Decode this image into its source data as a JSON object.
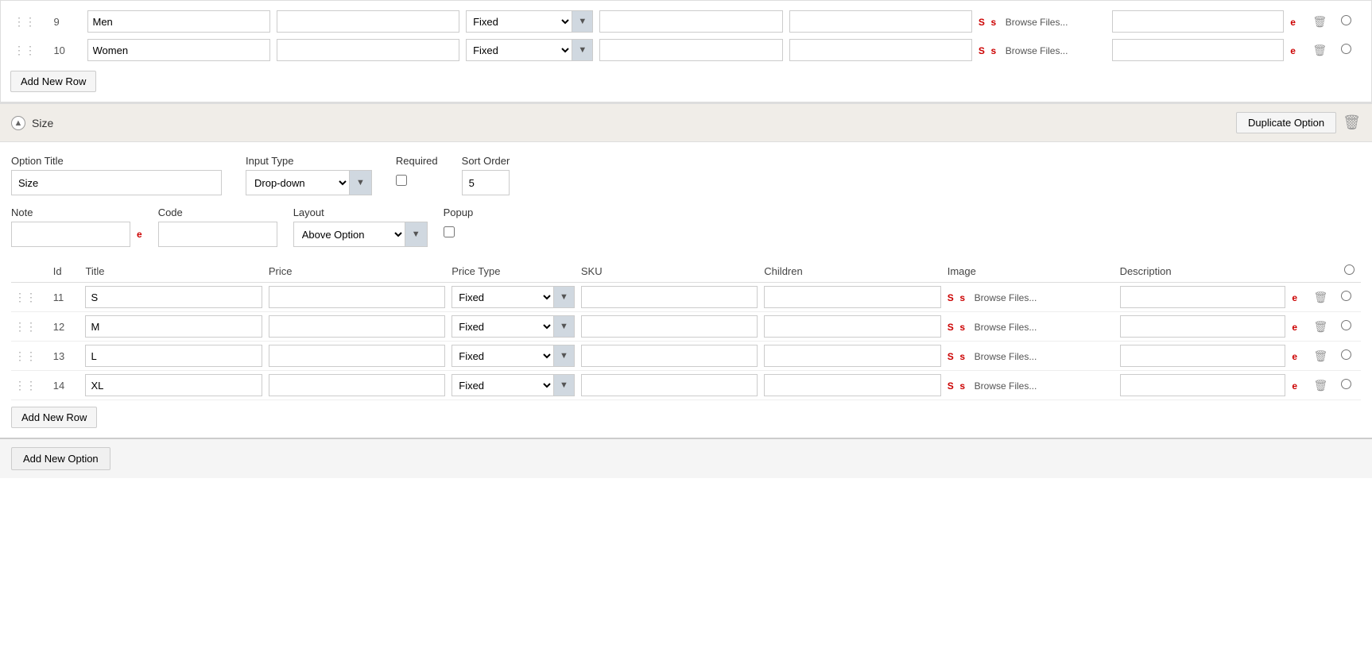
{
  "topRows": {
    "rows": [
      {
        "id": 9,
        "title": "Men",
        "price": "",
        "priceType": "Fixed",
        "sku": "",
        "children": "",
        "imageBrowse": "Browse Files...",
        "description": ""
      },
      {
        "id": 10,
        "title": "Women",
        "price": "",
        "priceType": "Fixed",
        "sku": "",
        "children": "",
        "imageBrowse": "Browse Files...",
        "description": ""
      }
    ],
    "addRowLabel": "Add New Row"
  },
  "sizeSection": {
    "title": "Size",
    "collapseIcon": "▲",
    "duplicateLabel": "Duplicate Option",
    "optionTitleLabel": "Option Title",
    "optionTitleValue": "Size",
    "inputTypeLabel": "Input Type",
    "inputTypeValue": "Drop-down",
    "requiredLabel": "Required",
    "sortOrderLabel": "Sort Order",
    "sortOrderValue": "5",
    "noteLabel": "Note",
    "noteValue": "",
    "codeLabel": "Code",
    "codeValue": "",
    "layoutLabel": "Layout",
    "layoutValue": "Above Option",
    "popupLabel": "Popup",
    "tableHeaders": {
      "id": "Id",
      "title": "Title",
      "price": "Price",
      "priceType": "Price Type",
      "sku": "SKU",
      "children": "Children",
      "image": "Image",
      "description": "Description"
    },
    "rows": [
      {
        "id": 11,
        "title": "S",
        "price": "",
        "priceType": "Fixed",
        "sku": "",
        "children": "",
        "imageBrowse": "Browse Files...",
        "description": ""
      },
      {
        "id": 12,
        "title": "M",
        "price": "",
        "priceType": "Fixed",
        "sku": "",
        "children": "",
        "imageBrowse": "Browse Files...",
        "description": ""
      },
      {
        "id": 13,
        "title": "L",
        "price": "",
        "priceType": "Fixed",
        "sku": "",
        "children": "",
        "imageBrowse": "Browse Files...",
        "description": ""
      },
      {
        "id": 14,
        "title": "XL",
        "price": "",
        "priceType": "Fixed",
        "sku": "",
        "children": "",
        "imageBrowse": "Browse Files...",
        "description": ""
      }
    ],
    "addRowLabel": "Add New Row",
    "sLabel": "S",
    "smallSLabel": "s"
  },
  "footer": {
    "addOptionLabel": "Add New Option"
  },
  "colors": {
    "sLink": "#cc0000",
    "eLink": "#cc0000",
    "sectionHeaderBg": "#f0ede8"
  }
}
